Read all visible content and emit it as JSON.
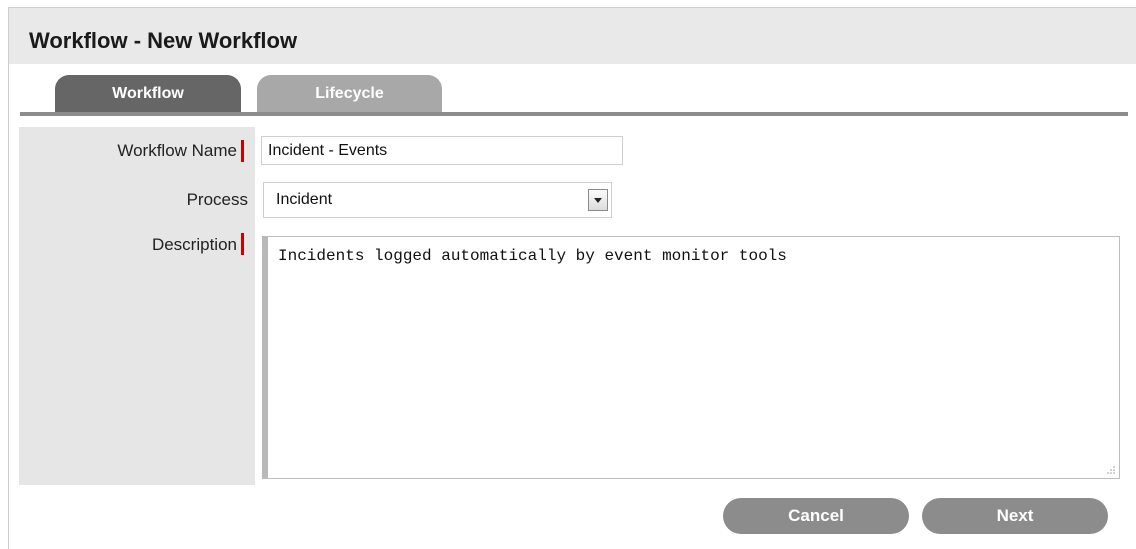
{
  "header": {
    "title": "Workflow - New Workflow"
  },
  "tabs": [
    {
      "label": "Workflow",
      "active": true
    },
    {
      "label": "Lifecycle",
      "active": false
    }
  ],
  "form": {
    "workflow_name": {
      "label": "Workflow Name",
      "value": "Incident - Events",
      "required": true
    },
    "process": {
      "label": "Process",
      "selected": "Incident",
      "required": false
    },
    "description": {
      "label": "Description",
      "value": "Incidents logged automatically by event monitor tools",
      "required": true
    }
  },
  "actions": {
    "cancel_label": "Cancel",
    "next_label": "Next"
  },
  "colors": {
    "required_marker": "#cc0000",
    "tab_active": "#666666",
    "tab_inactive": "#a8a8a8",
    "button": "#8c8c8c"
  },
  "icons": {
    "select_arrow": "chevron-down-icon",
    "resize_grip": "resize-grip-icon"
  }
}
